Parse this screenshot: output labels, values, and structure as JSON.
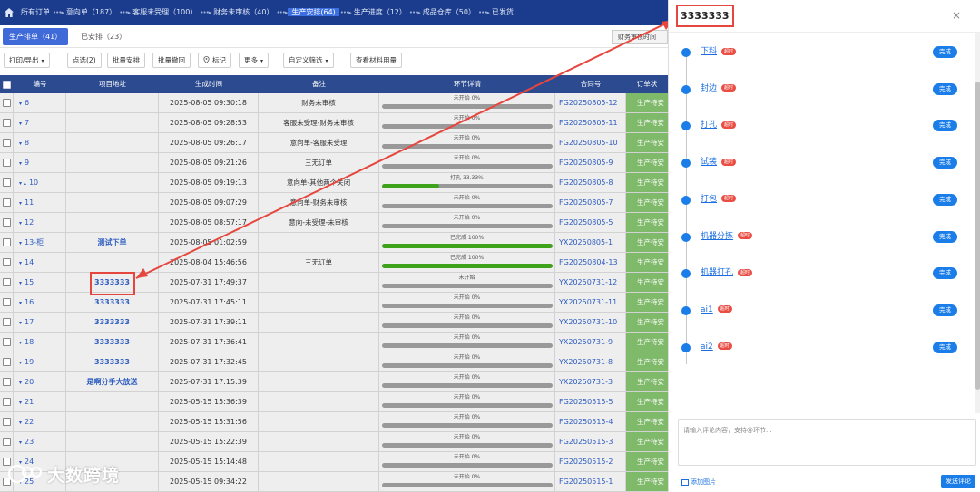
{
  "topnav": {
    "steps": [
      {
        "label": "所有订单"
      },
      {
        "label": "意向单（187）"
      },
      {
        "label": "客服未受理（100）"
      },
      {
        "label": "财务未审核（40）"
      },
      {
        "label": "生产安排(64)"
      },
      {
        "label": "生产进度（12）"
      },
      {
        "label": "成品仓库（50）"
      },
      {
        "label": "已发货"
      }
    ],
    "separator": "•••▸"
  },
  "subtabs": {
    "active": "生产排单（41）",
    "other": "已安排（23）",
    "right_button": "财务审核时间"
  },
  "toolbar": {
    "buttons": [
      "打印/导出",
      "点选(2)",
      "批量安排",
      "批量撤回",
      "标记",
      "更多",
      "自定义筛选",
      "查看材料用量"
    ],
    "caret": "▾"
  },
  "table": {
    "headers": [
      "编号",
      "项目地址",
      "生成时间",
      "备注",
      "环节详情",
      "合同号",
      "订单状"
    ],
    "rows": [
      {
        "no": "6",
        "addr": "",
        "time": "2025-08-05 09:30:18",
        "note": "财务未审核",
        "progress_label": "未开始 0%",
        "progress": 0,
        "contract": "FG20250805-12",
        "status": "生产待安"
      },
      {
        "no": "7",
        "addr": "",
        "time": "2025-08-05 09:28:53",
        "note": "客服未受理-财务未审核",
        "progress_label": "未开始 0%",
        "progress": 0,
        "contract": "FG20250805-11",
        "status": "生产待安"
      },
      {
        "no": "8",
        "addr": "",
        "time": "2025-08-05 09:26:17",
        "note": "意向单-客服未受理",
        "progress_label": "未开始 0%",
        "progress": 0,
        "contract": "FG20250805-10",
        "status": "生产待安"
      },
      {
        "no": "9",
        "addr": "",
        "time": "2025-08-05 09:21:26",
        "note": "三无订单",
        "progress_label": "未开始 0%",
        "progress": 0,
        "contract": "FG20250805-9",
        "status": "生产待安"
      },
      {
        "no": "10",
        "addr": "",
        "time": "2025-08-05 09:19:13",
        "note": "意向单-其他两个关闭",
        "progress_label": "打孔 33.33%",
        "progress": 33.33,
        "contract": "FG20250805-8",
        "status": "生产待安"
      },
      {
        "no": "11",
        "addr": "",
        "time": "2025-08-05 09:07:29",
        "note": "意向单-财务未审核",
        "progress_label": "未开始 0%",
        "progress": 0,
        "contract": "FG20250805-7",
        "status": "生产待安"
      },
      {
        "no": "12",
        "addr": "",
        "time": "2025-08-05 08:57:17",
        "note": "意向-未受理-未审核",
        "progress_label": "未开始 0%",
        "progress": 0,
        "contract": "FG20250805-5",
        "status": "生产待安"
      },
      {
        "no": "13-柜",
        "addr": "测试下单",
        "time": "2025-08-05 01:02:59",
        "note": "",
        "progress_label": "已完成 100%",
        "progress": 100,
        "contract": "YX20250805-1",
        "status": "生产待安"
      },
      {
        "no": "14",
        "addr": "",
        "time": "2025-08-04 15:46:56",
        "note": "三无订单",
        "progress_label": "已完成 100%",
        "progress": 100,
        "contract": "FG20250804-13",
        "status": "生产待安"
      },
      {
        "no": "15",
        "addr": "3333333",
        "time": "2025-07-31 17:49:37",
        "note": "",
        "progress_label": "未开始",
        "progress": 0,
        "contract": "YX20250731-12",
        "status": "生产待安"
      },
      {
        "no": "16",
        "addr": "3333333",
        "time": "2025-07-31 17:45:11",
        "note": "",
        "progress_label": "未开始 0%",
        "progress": 0,
        "contract": "YX20250731-11",
        "status": "生产待安"
      },
      {
        "no": "17",
        "addr": "3333333",
        "time": "2025-07-31 17:39:11",
        "note": "",
        "progress_label": "未开始 0%",
        "progress": 0,
        "contract": "YX20250731-10",
        "status": "生产待安"
      },
      {
        "no": "18",
        "addr": "3333333",
        "time": "2025-07-31 17:36:41",
        "note": "",
        "progress_label": "未开始 0%",
        "progress": 0,
        "contract": "YX20250731-9",
        "status": "生产待安"
      },
      {
        "no": "19",
        "addr": "3333333",
        "time": "2025-07-31 17:32:45",
        "note": "",
        "progress_label": "未开始 0%",
        "progress": 0,
        "contract": "YX20250731-8",
        "status": "生产待安"
      },
      {
        "no": "20",
        "addr": "是啊分手大放送",
        "time": "2025-07-31 17:15:39",
        "note": "",
        "progress_label": "未开始 0%",
        "progress": 0,
        "contract": "YX20250731-3",
        "status": "生产待安"
      },
      {
        "no": "21",
        "addr": "",
        "time": "2025-05-15 15:36:39",
        "note": "",
        "progress_label": "未开始 0%",
        "progress": 0,
        "contract": "FG20250515-5",
        "status": "生产待安"
      },
      {
        "no": "22",
        "addr": "",
        "time": "2025-05-15 15:31:56",
        "note": "",
        "progress_label": "未开始 0%",
        "progress": 0,
        "contract": "FG20250515-4",
        "status": "生产待安"
      },
      {
        "no": "23",
        "addr": "",
        "time": "2025-05-15 15:22:39",
        "note": "",
        "progress_label": "未开始 0%",
        "progress": 0,
        "contract": "FG20250515-3",
        "status": "生产待安"
      },
      {
        "no": "24",
        "addr": "",
        "time": "2025-05-15 15:14:48",
        "note": "",
        "progress_label": "未开始 0%",
        "progress": 0,
        "contract": "FG20250515-2",
        "status": "生产待安"
      },
      {
        "no": "25",
        "addr": "",
        "time": "2025-05-15 09:34:22",
        "note": "",
        "progress_label": "未开始 0%",
        "progress": 0,
        "contract": "FG20250515-1",
        "status": "生产待安"
      }
    ]
  },
  "panel": {
    "title": "3333333",
    "close": "×",
    "steps": [
      {
        "name": "下料",
        "tag": "超时",
        "action": "完成"
      },
      {
        "name": "封边",
        "tag": "超时",
        "action": "完成"
      },
      {
        "name": "打孔",
        "tag": "超时",
        "action": "完成"
      },
      {
        "name": "试装",
        "tag": "超时",
        "action": "完成"
      },
      {
        "name": "打包",
        "tag": "超时",
        "action": "完成"
      },
      {
        "name": "机器分拣",
        "tag": "超时",
        "action": "完成"
      },
      {
        "name": "机器打孔",
        "tag": "超时",
        "action": "完成"
      },
      {
        "name": "ai1",
        "tag": "超时",
        "action": "完成"
      },
      {
        "name": "ai2",
        "tag": "超时",
        "action": "完成"
      }
    ],
    "comment_placeholder": "请输入评论内容，支持@环节...",
    "add_image": "添加图片",
    "send": "发送评论"
  },
  "watermark": "大数跨境",
  "colors": {
    "nav_bg": "#1b3c8c",
    "nav_active": "#3c6fe0",
    "header_bg": "#2b4a8f",
    "accent": "#1a7de8",
    "status_green": "#7fb96a",
    "progress_green": "#3ea21a",
    "annotation_red": "#e5463e",
    "tag_red": "#ea4d43"
  }
}
